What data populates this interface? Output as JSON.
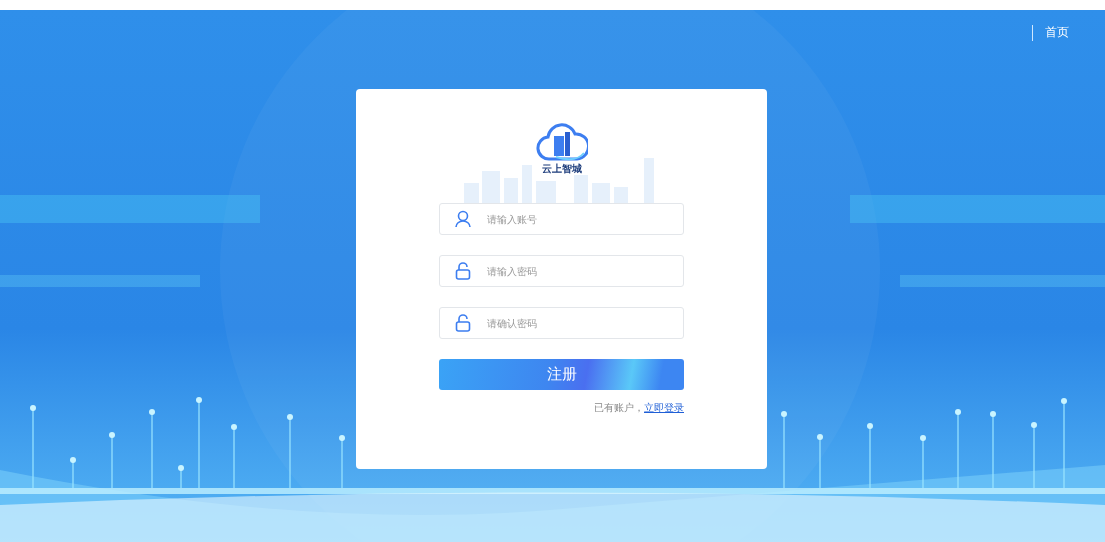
{
  "nav": {
    "link": "首页"
  },
  "logo": {
    "text": "云上智城"
  },
  "fields": [
    {
      "kind": "user",
      "placeholder": "请输入账号"
    },
    {
      "kind": "lock",
      "placeholder": "请输入密码"
    },
    {
      "kind": "lock",
      "placeholder": "请确认密码"
    }
  ],
  "submit": "注册",
  "footer": {
    "text": "已有账户，",
    "link": "立即登录"
  }
}
